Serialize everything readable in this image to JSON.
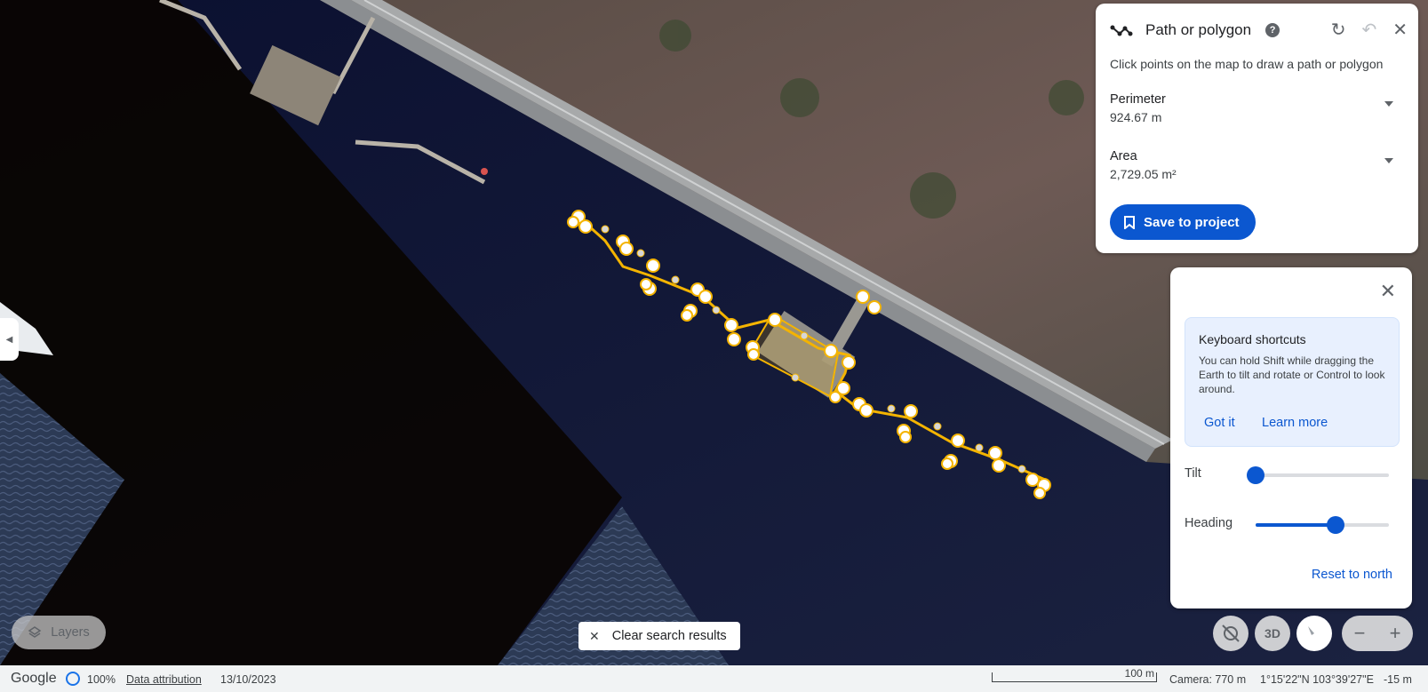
{
  "measure_panel": {
    "title": "Path or polygon",
    "hint": "Click points on the map to draw a path or polygon",
    "perimeter_label": "Perimeter",
    "perimeter_value": "924.67 m",
    "area_label": "Area",
    "area_value": "2,729.05 m²",
    "save_label": "Save to project"
  },
  "nav_panel": {
    "tip_title": "Keyboard shortcuts",
    "tip_body": "You can hold Shift while dragging the Earth to tilt and rotate or Control to look around.",
    "got_it": "Got it",
    "learn_more": "Learn more",
    "tilt_label": "Tilt",
    "tilt_value": 0.0,
    "heading_label": "Heading",
    "heading_value": 0.6,
    "reset_label": "Reset to north"
  },
  "map_controls": {
    "layers_label": "Layers",
    "clear_label": "Clear search results",
    "three_d_label": "3D",
    "zoom_out": "−",
    "zoom_in": "+"
  },
  "status_bar": {
    "brand": "Google",
    "load_percent": "100%",
    "attribution": "Data attribution",
    "date": "13/10/2023",
    "scale_label": "100 m",
    "camera": "Camera: 770 m",
    "coords": "1°15'22\"N 103°39'27\"E",
    "elevation": "-15 m"
  },
  "colors": {
    "accent": "#0b57d0",
    "path": "#f4b400"
  }
}
